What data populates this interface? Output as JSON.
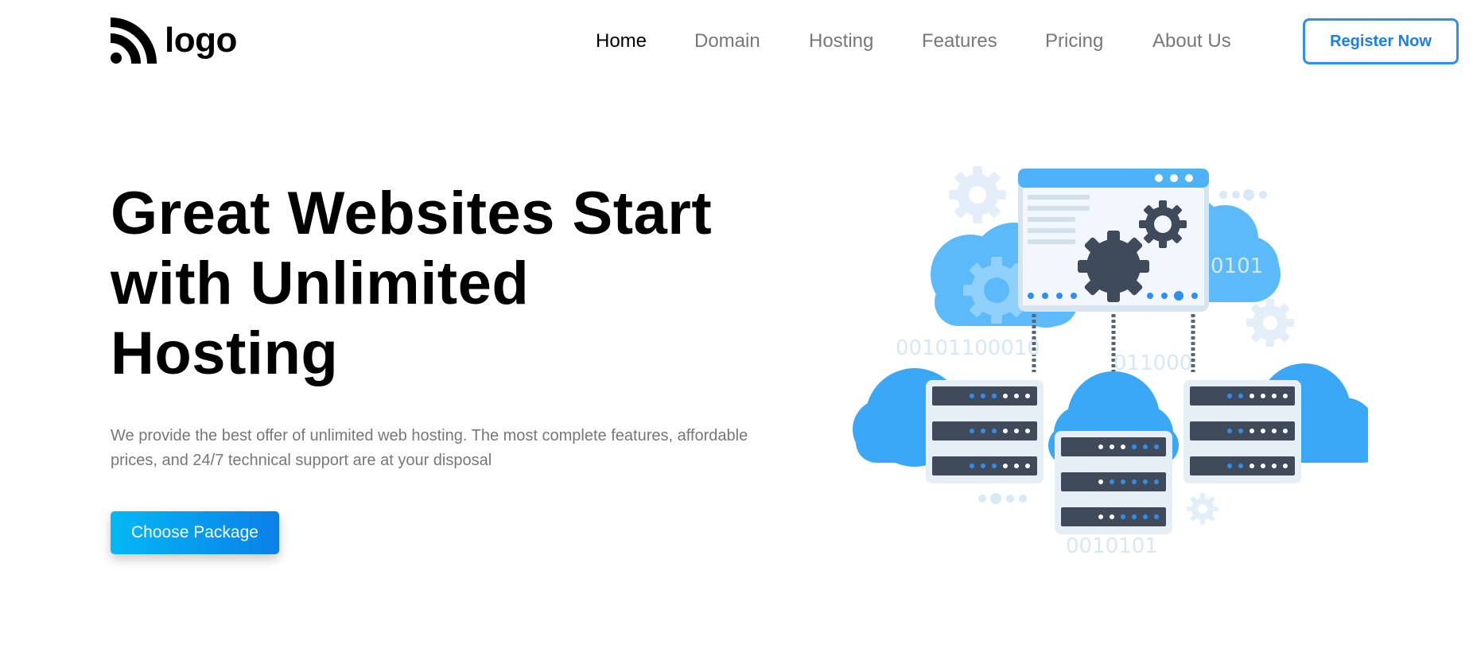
{
  "header": {
    "logo_text": "logo",
    "nav": [
      {
        "label": "Home",
        "active": true
      },
      {
        "label": "Domain",
        "active": false
      },
      {
        "label": "Hosting",
        "active": false
      },
      {
        "label": "Features",
        "active": false
      },
      {
        "label": "Pricing",
        "active": false
      },
      {
        "label": "About Us",
        "active": false
      }
    ],
    "register_label": "Register Now"
  },
  "hero": {
    "title_lines": [
      "Great Websites Start",
      "with Unlimited",
      "Hosting"
    ],
    "description_lines": [
      "We provide the best offer of unlimited web hosting. The most complete features, affordable",
      "prices, and 24/7 technical support are at your disposal"
    ],
    "cta_label": "Choose Package"
  },
  "illustration": {
    "binary_texts": [
      "0101",
      "00101100010",
      "011000",
      "0010101"
    ],
    "icons": [
      "cloud-icon",
      "gear-icon",
      "browser-window-icon",
      "server-rack-icon"
    ]
  },
  "colors": {
    "accent": "#2f8ff0",
    "cta_gradient_start": "#03b8f5",
    "cta_gradient_end": "#0c7fe8",
    "text_muted": "#777777",
    "cloud_blue": "#5cbaf8",
    "server_dark": "#3f4a5a"
  }
}
